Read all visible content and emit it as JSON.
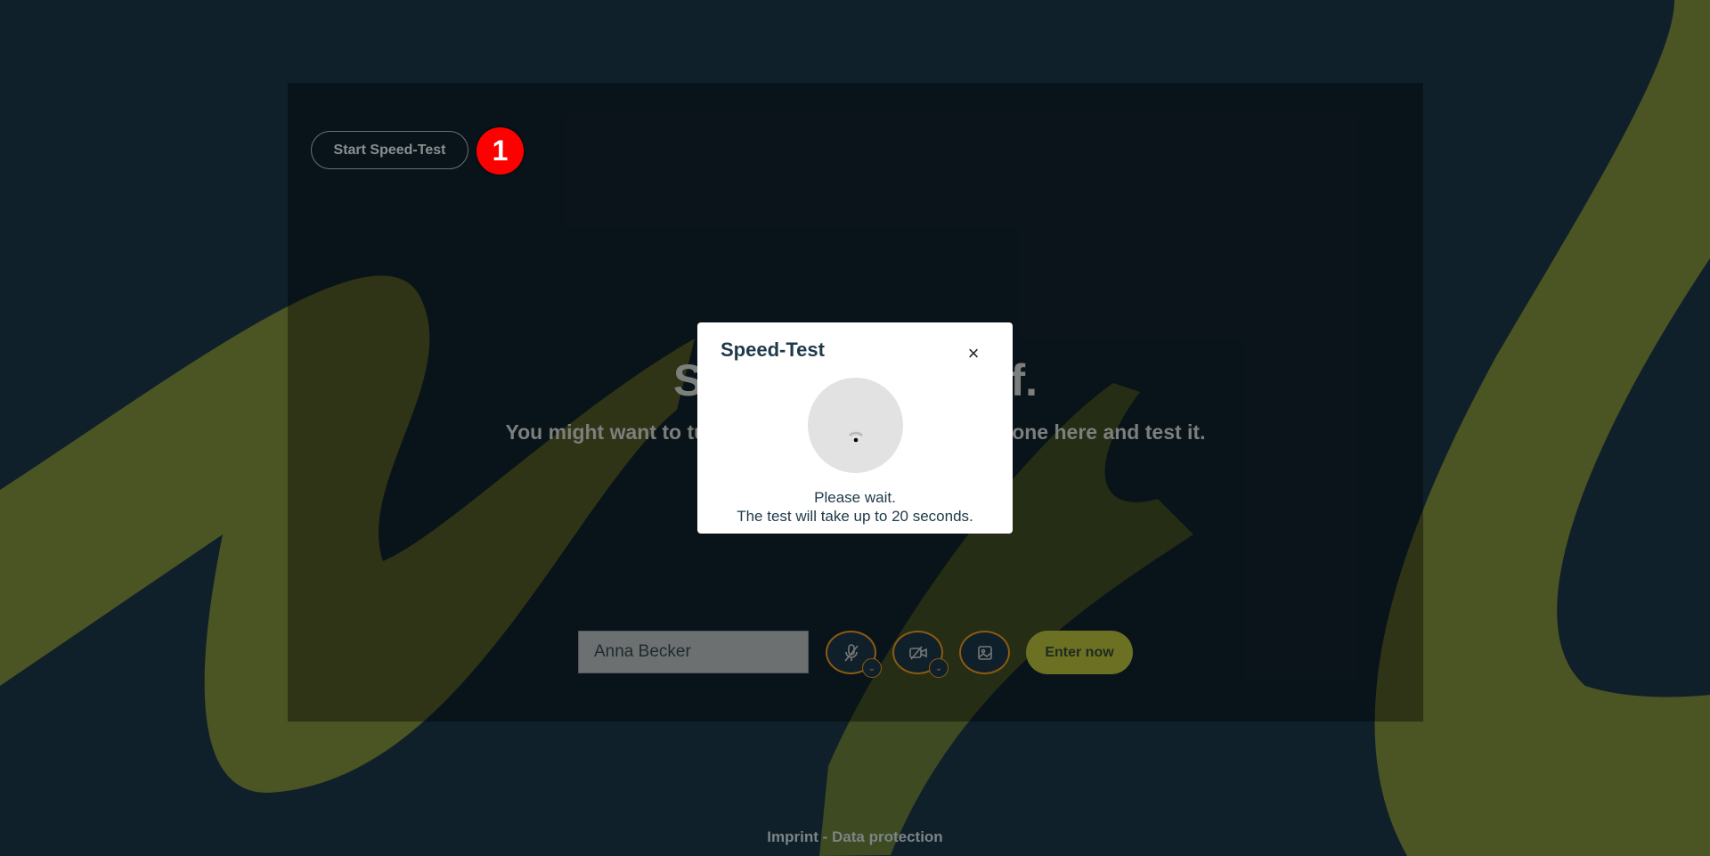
{
  "toolbar": {
    "start_speed_test": "Start Speed-Test",
    "step_badge": "1"
  },
  "hero": {
    "headline_left": "Say",
    "headline_right": "self.",
    "subtitle_left": "You might want to tur",
    "subtitle_right": "hone here and test it."
  },
  "form": {
    "name_value": "Anna Becker",
    "enter_label": "Enter now"
  },
  "footer": {
    "links": "Imprint - Data protection"
  },
  "dialog": {
    "title": "Speed-Test",
    "line1": "Please wait.",
    "line2": "The test will take up to 20 seconds."
  },
  "colors": {
    "background": "#10202a",
    "accent": "#6b7022",
    "badge": "#ff0000",
    "device_border": "#8a5a10"
  },
  "icons": {
    "mic": "microphone-off-icon",
    "camera": "camera-off-icon",
    "image": "image-icon",
    "close": "close-icon"
  }
}
